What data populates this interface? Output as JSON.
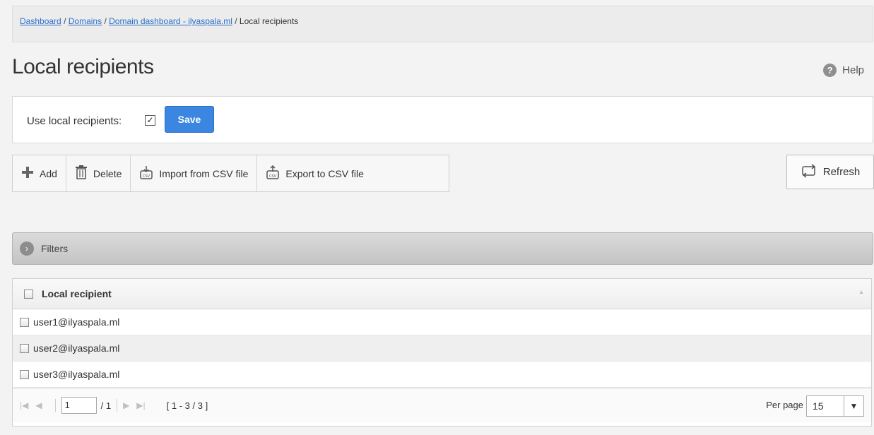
{
  "breadcrumb": {
    "items": [
      {
        "label": "Dashboard",
        "link": true
      },
      {
        "label": "Domains",
        "link": true
      },
      {
        "label": "Domain dashboard - ilyaspala.ml",
        "link": true
      },
      {
        "label": "Local recipients",
        "link": false
      }
    ],
    "separator": "/"
  },
  "page": {
    "title": "Local recipients",
    "help_label": "Help",
    "help_icon": "?"
  },
  "use_local": {
    "label": "Use local recipients:",
    "checked": true,
    "check_glyph": "✓",
    "save_label": "Save"
  },
  "toolbar": {
    "add_label": "Add",
    "delete_label": "Delete",
    "import_label": "Import from CSV file",
    "export_label": "Export to CSV file",
    "refresh_label": "Refresh"
  },
  "filters": {
    "label": "Filters",
    "arrow_glyph": "›"
  },
  "grid": {
    "column_header": "Local recipient",
    "rows": [
      "user1@ilyaspala.ml",
      "user2@ilyaspala.ml",
      "user3@ilyaspala.ml"
    ]
  },
  "pager": {
    "current_page": "1",
    "total_pages": "/ 1",
    "range": "[ 1 - 3 / 3 ]",
    "per_page_label": "Per page",
    "per_page_value": "15"
  },
  "colors": {
    "link": "#2a6fc9",
    "save_bg": "#3a86e0"
  }
}
